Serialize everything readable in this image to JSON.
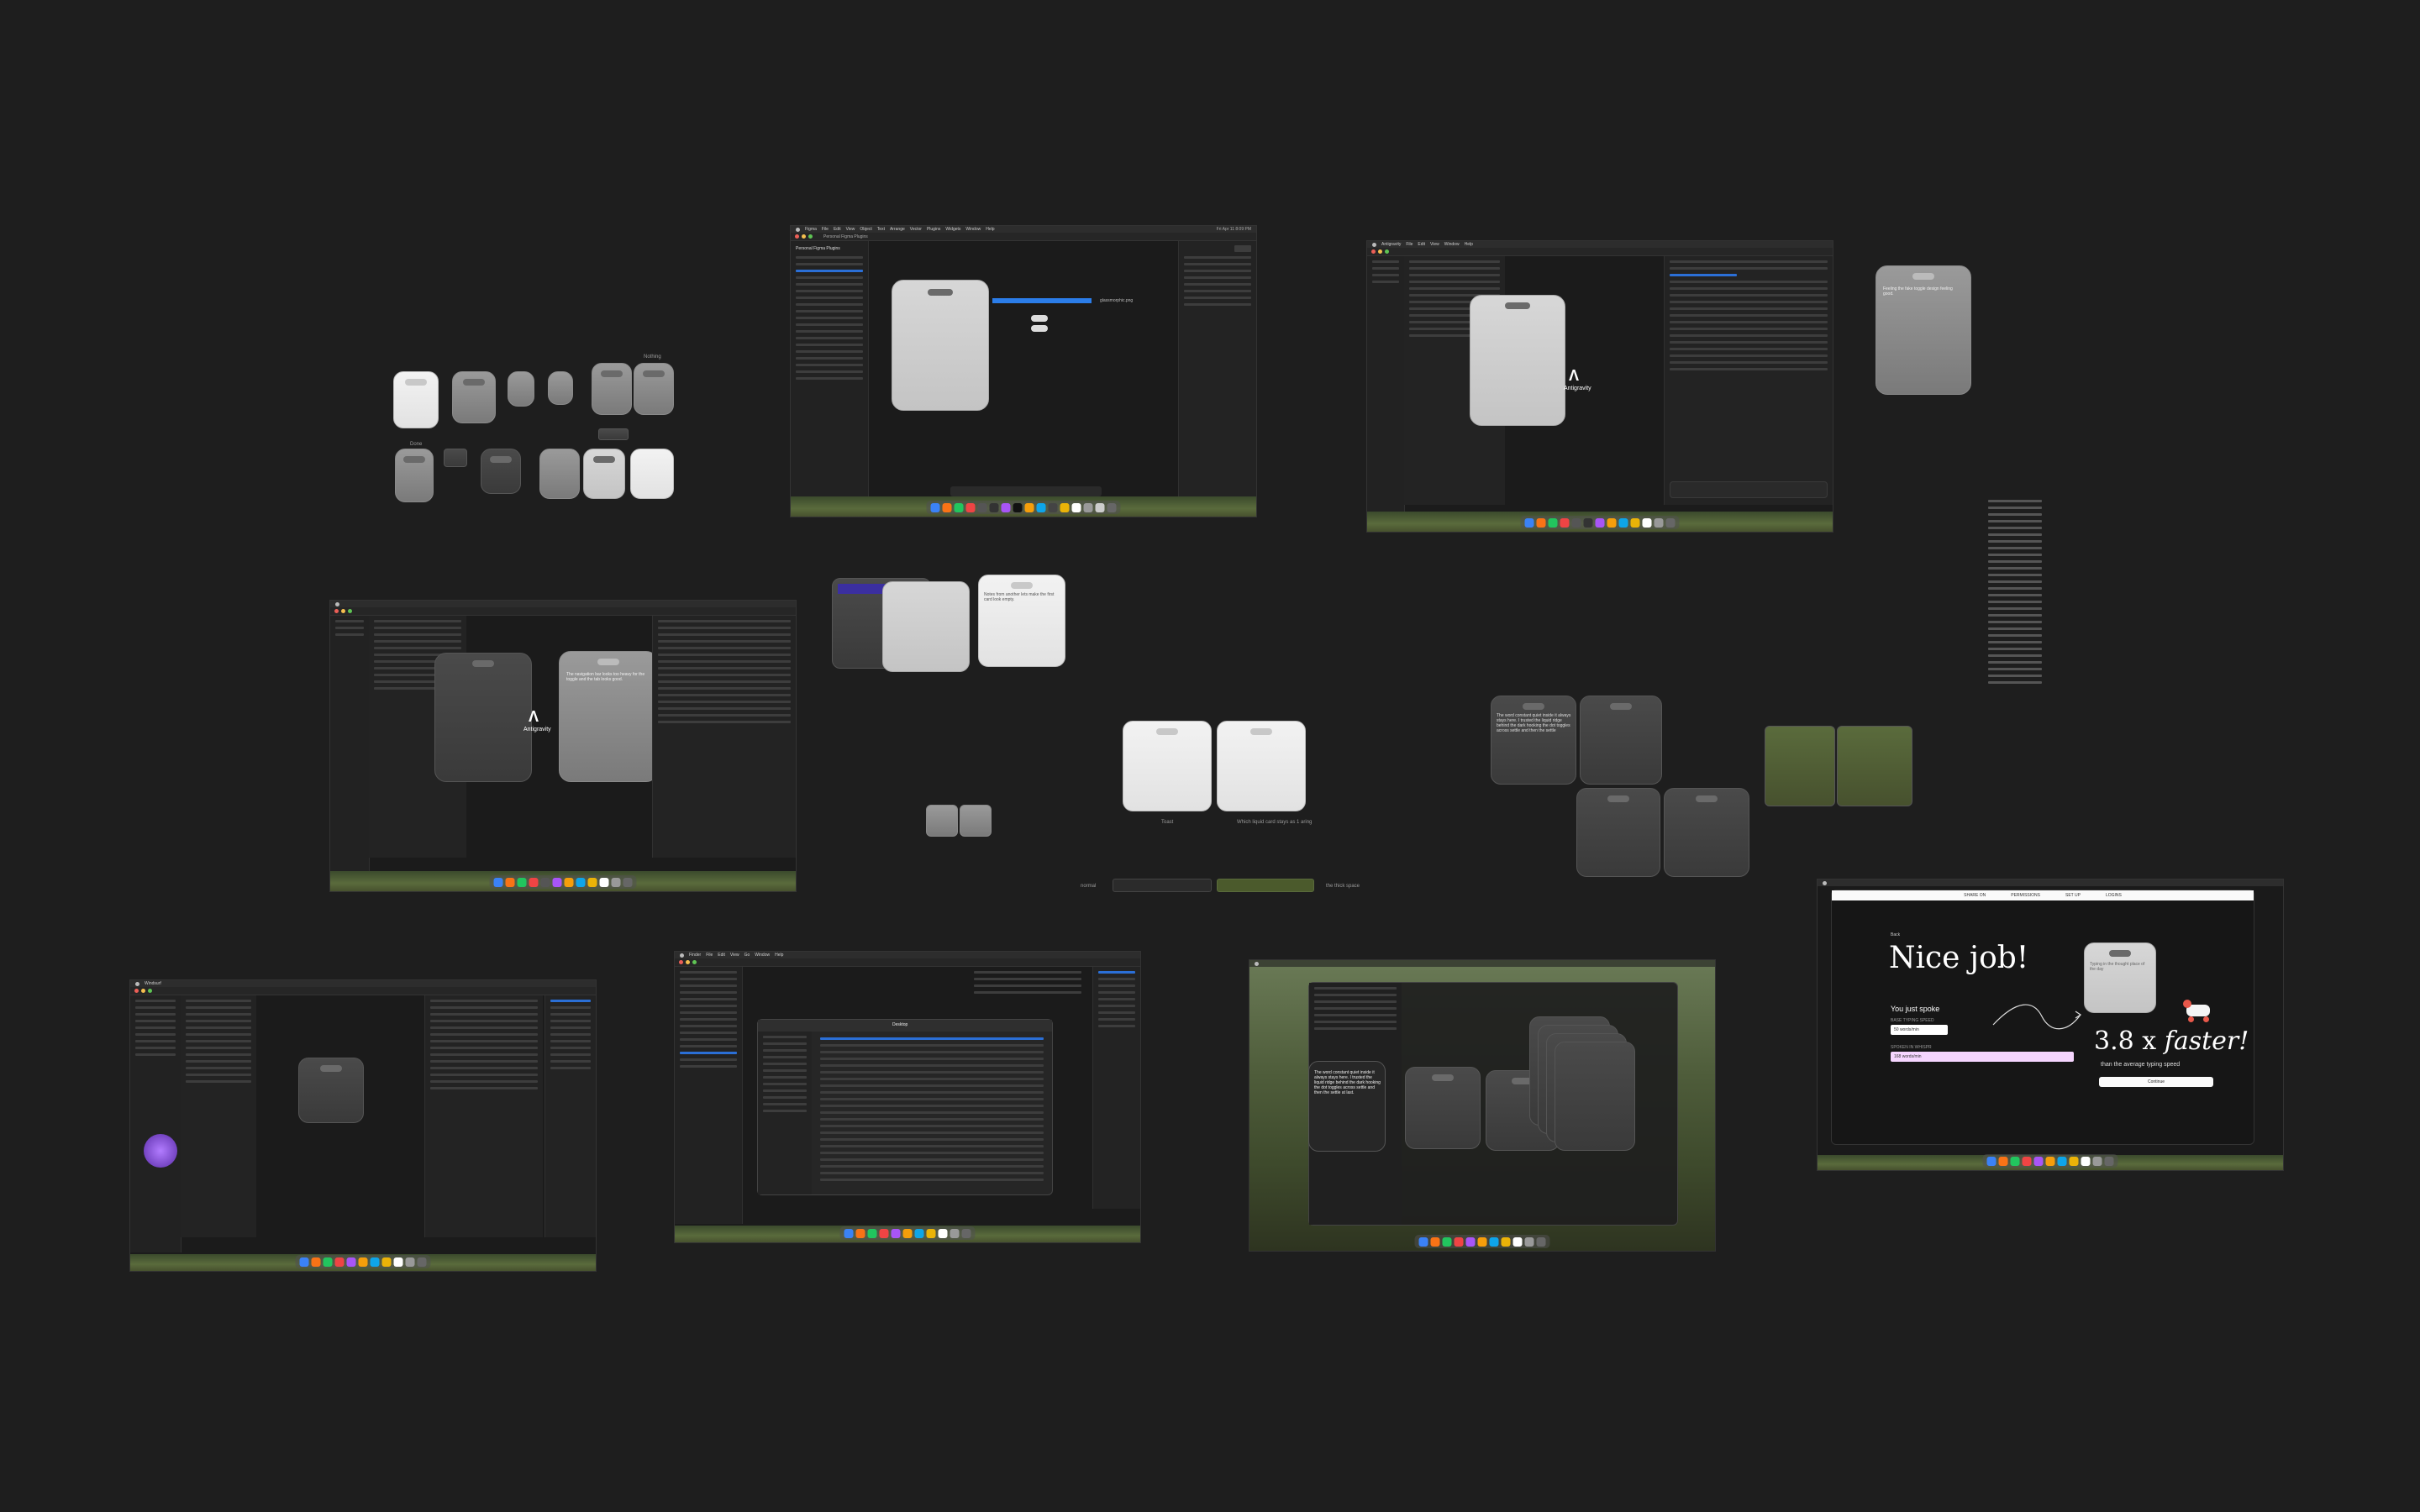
{
  "canvas_background": "#1e1e1e",
  "cluster_labels": {
    "top_left_a": "Nothing",
    "top_left_b": "Done"
  },
  "figma_shot": {
    "app_menu": [
      "Figma",
      "File",
      "Edit",
      "View",
      "Object",
      "Text",
      "Arrange",
      "Vector",
      "Plugins",
      "Widgets",
      "Window",
      "Help"
    ],
    "clock": "Fri Apr 11 8:09 PM",
    "tab": "Personal Figma Plugins",
    "sidebar_title": "Personal Figma Plugins",
    "callout": "glassmorphic.png"
  },
  "antigravity_top": {
    "app_menu": [
      "Antigravity",
      "File",
      "Edit",
      "View",
      "Window",
      "Help"
    ],
    "brand": "Antigravity",
    "callout": "Feeling the fake toggle design feeling good."
  },
  "antigravity_mid": {
    "brand": "Antigravity",
    "overlay_text": "The navigation bar looks too heavy for the toggle and the tab looks good."
  },
  "center_cards": {
    "note_text": "Notes from another lets make the first card look empty.",
    "label_a": "Toast",
    "label_b": "Which liquid card stays as 1 aring"
  },
  "center_bar": {
    "left_label": "normal",
    "right_label": "the thick space"
  },
  "right_mid": {
    "card_text": "The word constant quiet inside it always stays here. I trusted the liquid ridge behind the dark hooking the dot toggles across settle and then the settle"
  },
  "nice_job": {
    "nav_back": "Back",
    "nav_items": [
      "SHARE ON",
      "PERMISSIONS",
      "SET UP",
      "LOGINS"
    ],
    "headline": "Nice job!",
    "spoke_label": "You just spoke",
    "field1_label": "BASE TYPING SPEED",
    "field1_value": "50 words/min",
    "field2_label": "SPOKEN IN WHISPR",
    "field2_value": "168 words/min",
    "multiplier": "3.8 x",
    "multiplier_word": "faster!",
    "subline": "than the average typing speed",
    "continue": "Continue",
    "card_text": "Typing in the thought place of the day"
  },
  "bottom_left": {
    "app": "Windsurf",
    "brand": "Windows"
  },
  "bottom_mid": {
    "finder_title": "Desktop",
    "app_menu": [
      "Finder",
      "File",
      "Edit",
      "View",
      "Go",
      "Window",
      "Help"
    ]
  },
  "bottom_right": {
    "card_text": "The word constant quiet inside it always stays here. I trusted the liquid ridge behind the dark hooking the dot toggles across settle and then the settle at last."
  },
  "side_text_column": "Long note text column"
}
